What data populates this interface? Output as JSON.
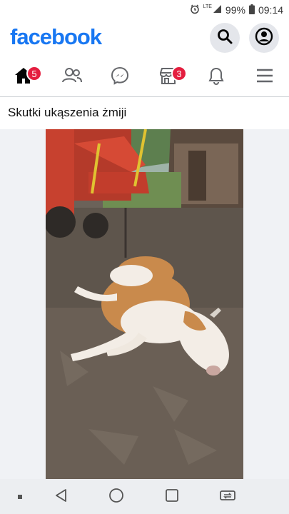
{
  "status": {
    "battery": "99%",
    "time": "09:14",
    "network": "LTE"
  },
  "header": {
    "logo": "facebook"
  },
  "nav": {
    "home_badge": "5",
    "marketplace_badge": "3"
  },
  "post": {
    "title": "Skutki ukąszenia żmiji"
  },
  "colors": {
    "brand": "#1877f2",
    "badge": "#e41e3f"
  }
}
